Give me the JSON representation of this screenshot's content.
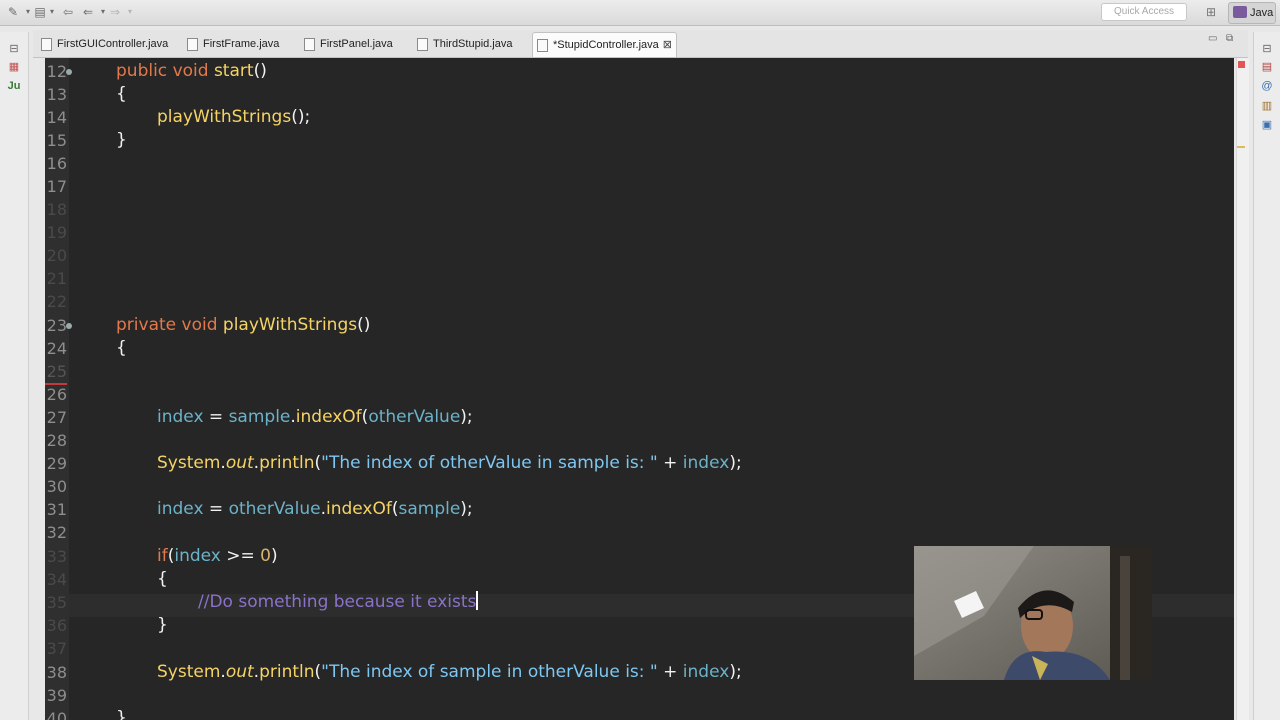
{
  "toolbar": {
    "quick_access_placeholder": "Quick Access",
    "perspective_label": "Java"
  },
  "tabs": [
    {
      "label": "FirstGUIController.java"
    },
    {
      "label": "FirstFrame.java"
    },
    {
      "label": "FirstPanel.java"
    },
    {
      "label": "ThirdStupid.java"
    },
    {
      "label": "*StupidController.java",
      "active": true,
      "close": "⊠"
    }
  ],
  "left_sidebar": {
    "junit_label": "Ju"
  },
  "editor": {
    "line_numbers": [
      "12",
      "13",
      "14",
      "15",
      "16",
      "17",
      "18",
      "19",
      "20",
      "21",
      "22",
      "23",
      "24",
      "25",
      "26",
      "27",
      "28",
      "29",
      "30",
      "31",
      "32",
      "33",
      "34",
      "35",
      "36",
      "37",
      "38",
      "39",
      "40"
    ],
    "lines": {
      "l12": {
        "kw1": "public",
        "kw2": "void",
        "fn": "start",
        "rest": "()"
      },
      "l13": "{",
      "l14": {
        "fn": "playWithStrings",
        "rest": "();"
      },
      "l15": "}",
      "l23": {
        "kw1": "private",
        "kw2": "void",
        "fn": "playWithStrings",
        "rest": "()"
      },
      "l24": "{",
      "l27": {
        "var1": "index",
        "op": " = ",
        "var2": "sample",
        "dot": ".",
        "fn": "indexOf",
        "p1": "(",
        "var3": "otherValue",
        "p2": ");"
      },
      "l29": {
        "cls": "System",
        "dot1": ".",
        "fld": "out",
        "dot2": ".",
        "fn": "println",
        "p1": "(",
        "str": "\"The index of otherValue in sample is: \"",
        "op": " + ",
        "var": "index",
        "p2": ");"
      },
      "l31": {
        "var1": "index",
        "op": " = ",
        "var2": "otherValue",
        "dot": ".",
        "fn": "indexOf",
        "p1": "(",
        "var3": "sample",
        "p2": ");"
      },
      "l33": {
        "kw": "if",
        "p1": "(",
        "var": "index",
        "op": " >= ",
        "num": "0",
        "p2": ")"
      },
      "l34": "{",
      "l35": "//Do something because it exists",
      "l36": "}",
      "l38": {
        "cls": "System",
        "dot1": ".",
        "fld": "out",
        "dot2": ".",
        "fn": "println",
        "p1": "(",
        "str": "\"The index of sample in otherValue is: \"",
        "op": " + ",
        "var": "index",
        "p2": ");"
      },
      "l40": "}"
    }
  },
  "colors": {
    "editor_bg": "#262626",
    "keyword": "#e3794b",
    "method": "#f6d365",
    "variable": "#6cb2c8",
    "string": "#7ec7f2",
    "comment": "#8a72c8"
  }
}
